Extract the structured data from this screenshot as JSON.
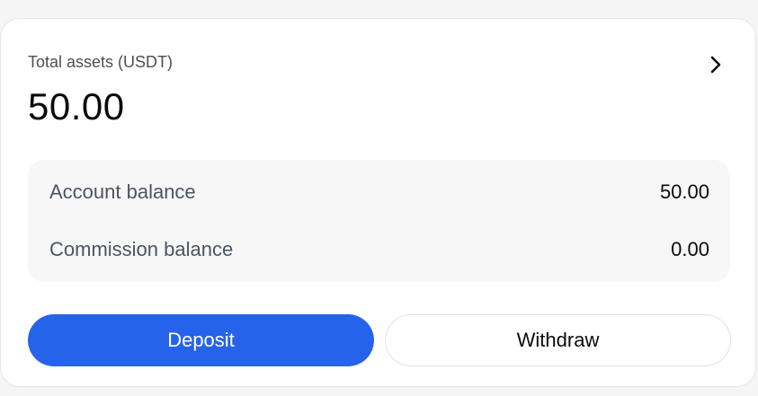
{
  "card": {
    "total_label": "Total assets (USDT)",
    "total_value": "50.00",
    "details_icon": "chevron-right-icon"
  },
  "balances": [
    {
      "label": "Account balance",
      "value": "50.00"
    },
    {
      "label": "Commission balance",
      "value": "0.00"
    }
  ],
  "actions": {
    "deposit_label": "Deposit",
    "withdraw_label": "Withdraw"
  },
  "colors": {
    "accent": "#2563eb",
    "panel": "#f7f7f7"
  }
}
